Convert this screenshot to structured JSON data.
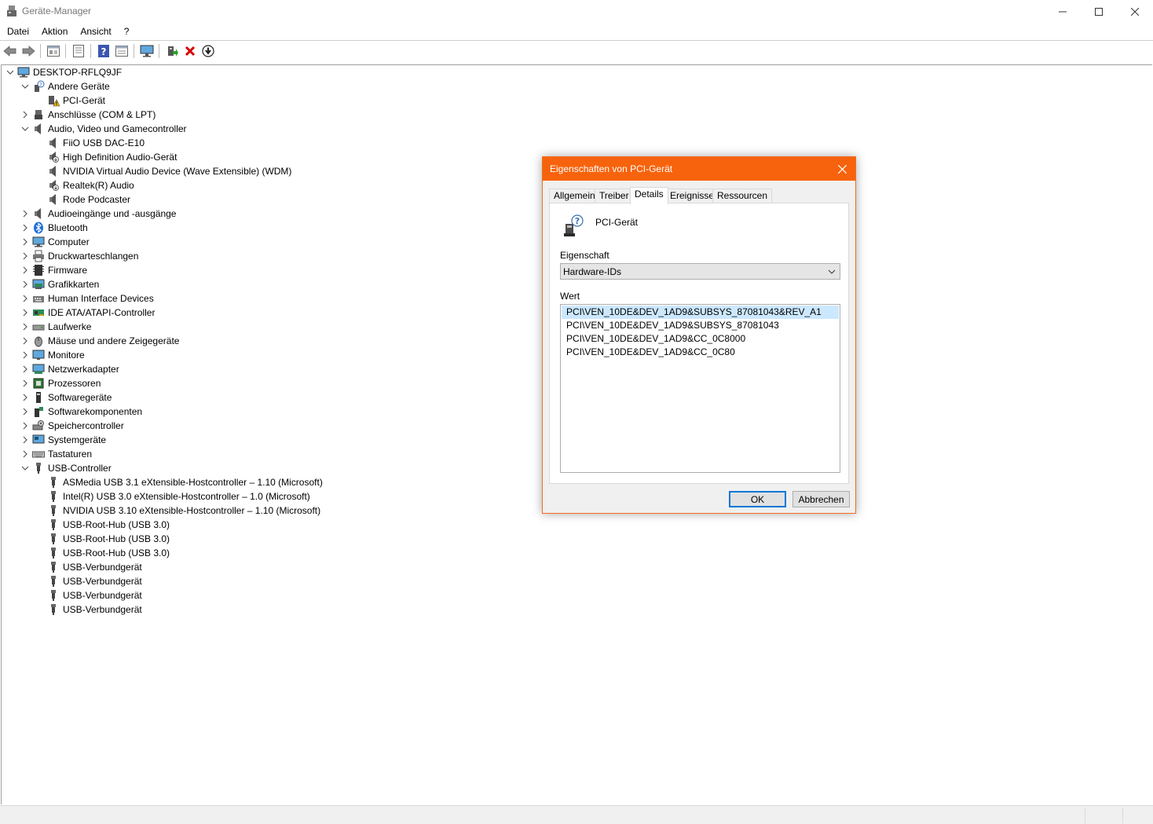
{
  "window": {
    "title": "Geräte-Manager"
  },
  "menu": [
    "Datei",
    "Aktion",
    "Ansicht",
    "?"
  ],
  "toolbar": {
    "icons": [
      "back-arrow-icon",
      "forward-arrow-icon",
      "show-hidden-icon",
      "properties-icon",
      "help-icon",
      "view-icon",
      "monitor-icon",
      "update-driver-icon",
      "uninstall-icon",
      "download-icon"
    ]
  },
  "tree": {
    "root": "DESKTOP-RFLQ9JF",
    "nodes": [
      {
        "label": "Andere Geräte",
        "level": 1,
        "expanded": true,
        "icon": "unknown-device-icon"
      },
      {
        "label": "PCI-Gerät",
        "level": 2,
        "icon": "warning-device-icon"
      },
      {
        "label": "Anschlüsse (COM & LPT)",
        "level": 1,
        "expanded": false,
        "icon": "port-icon"
      },
      {
        "label": "Audio, Video und Gamecontroller",
        "level": 1,
        "expanded": true,
        "icon": "speaker-icon"
      },
      {
        "label": "FiiO USB DAC-E10",
        "level": 2,
        "icon": "speaker-icon"
      },
      {
        "label": "High Definition Audio-Gerät",
        "level": 2,
        "icon": "speaker-disabled-icon"
      },
      {
        "label": "NVIDIA Virtual Audio Device (Wave Extensible) (WDM)",
        "level": 2,
        "icon": "speaker-icon"
      },
      {
        "label": "Realtek(R) Audio",
        "level": 2,
        "icon": "speaker-disabled-icon"
      },
      {
        "label": "Rode Podcaster",
        "level": 2,
        "icon": "speaker-icon"
      },
      {
        "label": "Audioeingänge und -ausgänge",
        "level": 1,
        "expanded": false,
        "icon": "speaker-icon"
      },
      {
        "label": "Bluetooth",
        "level": 1,
        "expanded": false,
        "icon": "bluetooth-icon"
      },
      {
        "label": "Computer",
        "level": 1,
        "expanded": false,
        "icon": "computer-icon"
      },
      {
        "label": "Druckwarteschlangen",
        "level": 1,
        "expanded": false,
        "icon": "printer-icon"
      },
      {
        "label": "Firmware",
        "level": 1,
        "expanded": false,
        "icon": "firmware-icon"
      },
      {
        "label": "Grafikkarten",
        "level": 1,
        "expanded": false,
        "icon": "display-adapter-icon"
      },
      {
        "label": "Human Interface Devices",
        "level": 1,
        "expanded": false,
        "icon": "hid-icon"
      },
      {
        "label": "IDE ATA/ATAPI-Controller",
        "level": 1,
        "expanded": false,
        "icon": "ide-controller-icon"
      },
      {
        "label": "Laufwerke",
        "level": 1,
        "expanded": false,
        "icon": "drive-icon"
      },
      {
        "label": "Mäuse und andere Zeigegeräte",
        "level": 1,
        "expanded": false,
        "icon": "mouse-icon"
      },
      {
        "label": "Monitore",
        "level": 1,
        "expanded": false,
        "icon": "monitor-icon"
      },
      {
        "label": "Netzwerkadapter",
        "level": 1,
        "expanded": false,
        "icon": "network-adapter-icon"
      },
      {
        "label": "Prozessoren",
        "level": 1,
        "expanded": false,
        "icon": "processor-icon"
      },
      {
        "label": "Softwaregeräte",
        "level": 1,
        "expanded": false,
        "icon": "software-device-icon"
      },
      {
        "label": "Softwarekomponenten",
        "level": 1,
        "expanded": false,
        "icon": "software-component-icon"
      },
      {
        "label": "Speichercontroller",
        "level": 1,
        "expanded": false,
        "icon": "storage-controller-icon"
      },
      {
        "label": "Systemgeräte",
        "level": 1,
        "expanded": false,
        "icon": "system-device-icon"
      },
      {
        "label": "Tastaturen",
        "level": 1,
        "expanded": false,
        "icon": "keyboard-icon"
      },
      {
        "label": "USB-Controller",
        "level": 1,
        "expanded": true,
        "icon": "usb-icon"
      },
      {
        "label": "ASMedia USB 3.1 eXtensible-Hostcontroller – 1.10 (Microsoft)",
        "level": 2,
        "icon": "usb-icon"
      },
      {
        "label": "Intel(R) USB 3.0 eXtensible-Hostcontroller – 1.0 (Microsoft)",
        "level": 2,
        "icon": "usb-icon"
      },
      {
        "label": "NVIDIA USB 3.10 eXtensible-Hostcontroller – 1.10 (Microsoft)",
        "level": 2,
        "icon": "usb-icon"
      },
      {
        "label": "USB-Root-Hub (USB 3.0)",
        "level": 2,
        "icon": "usb-icon"
      },
      {
        "label": "USB-Root-Hub (USB 3.0)",
        "level": 2,
        "icon": "usb-icon"
      },
      {
        "label": "USB-Root-Hub (USB 3.0)",
        "level": 2,
        "icon": "usb-icon"
      },
      {
        "label": "USB-Verbundgerät",
        "level": 2,
        "icon": "usb-icon"
      },
      {
        "label": "USB-Verbundgerät",
        "level": 2,
        "icon": "usb-icon"
      },
      {
        "label": "USB-Verbundgerät",
        "level": 2,
        "icon": "usb-icon"
      },
      {
        "label": "USB-Verbundgerät",
        "level": 2,
        "icon": "usb-icon"
      }
    ]
  },
  "dialog": {
    "title": "Eigenschaften von PCI-Gerät",
    "accent_color": "#f7630c",
    "tabs": [
      "Allgemein",
      "Treiber",
      "Details",
      "Ereignisse",
      "Ressourcen"
    ],
    "active_tab": "Details",
    "device_name": "PCI-Gerät",
    "property_label": "Eigenschaft",
    "property_value": "Hardware-IDs",
    "value_label": "Wert",
    "values": [
      "PCI\\VEN_10DE&DEV_1AD9&SUBSYS_87081043&REV_A1",
      "PCI\\VEN_10DE&DEV_1AD9&SUBSYS_87081043",
      "PCI\\VEN_10DE&DEV_1AD9&CC_0C8000",
      "PCI\\VEN_10DE&DEV_1AD9&CC_0C80"
    ],
    "ok_label": "OK",
    "cancel_label": "Abbrechen"
  }
}
